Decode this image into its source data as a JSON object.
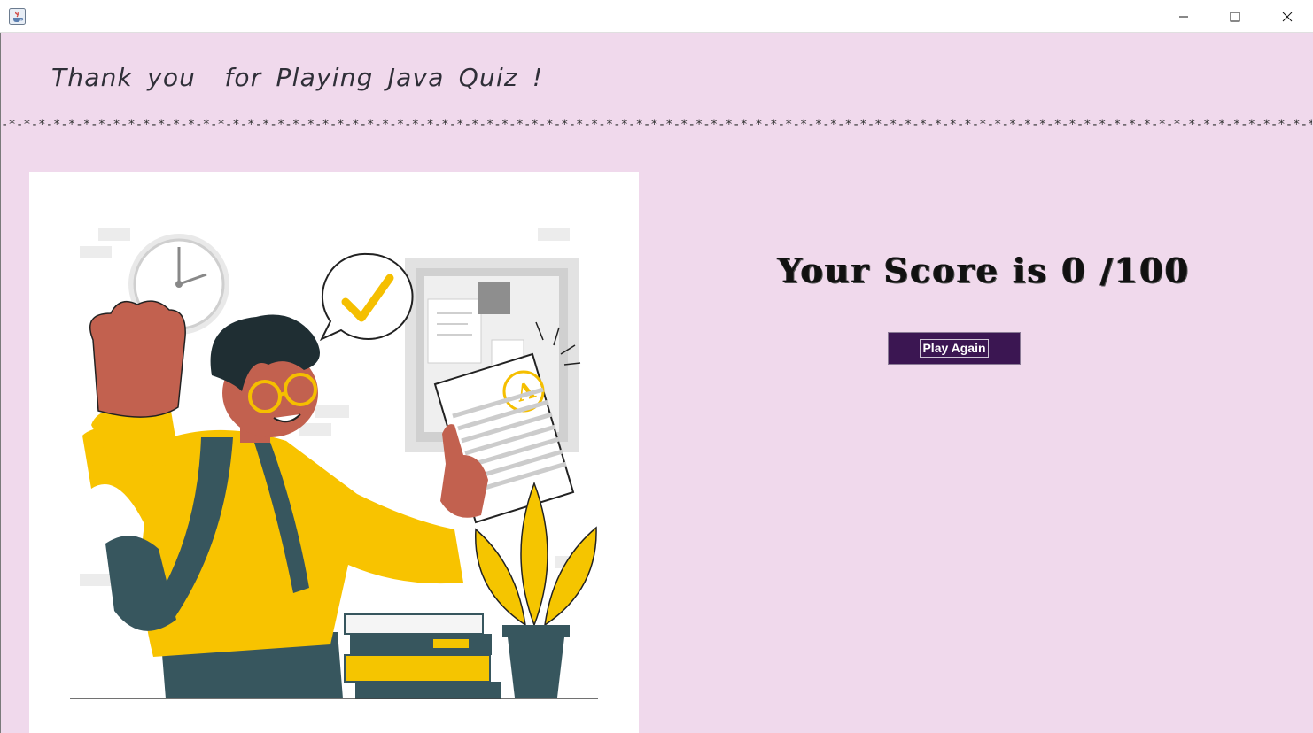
{
  "window": {
    "app_icon": "java-coffee-cup-icon",
    "controls": [
      "minimize-icon",
      "maximize-icon",
      "close-icon"
    ]
  },
  "header": {
    "thanks_text": "Thank you  for Playing Java Quiz !",
    "divider_text": "-*-*-*-*-*-*-*-*-*-*-*-*-*-*-*-*-*-*-*-*-*-*-*-*-*-*-*-*-*-*-*-*-*-*-*-*-*-*-*-*-*-*-*-*-*-*-*-*-*-*-*-*-*-*-*-*-*-*-*-*-*-*-*-*-*-*-*-*-*-*-*-*-*-*-*-*-*-*-*-*-*-*-*-*-*-*-*-*-*-*-*-*-*-*-*-*-*-*-*-*-*-*-*-*-*-*-*-*-*-*-*-*-*-*-*-*-*-*-*-*-*-*-*-*-*-*-*-*-*-*"
  },
  "result": {
    "score_text": "Your Score is 0 /100",
    "play_again_label": "Play Again"
  },
  "colors": {
    "background": "#f0d9ec",
    "button": "#3b1652",
    "accent_yellow": "#f8c300",
    "skin": "#c2614f",
    "bag": "#37565e"
  },
  "illustration": {
    "icon": "student-with-exam-illustration"
  }
}
